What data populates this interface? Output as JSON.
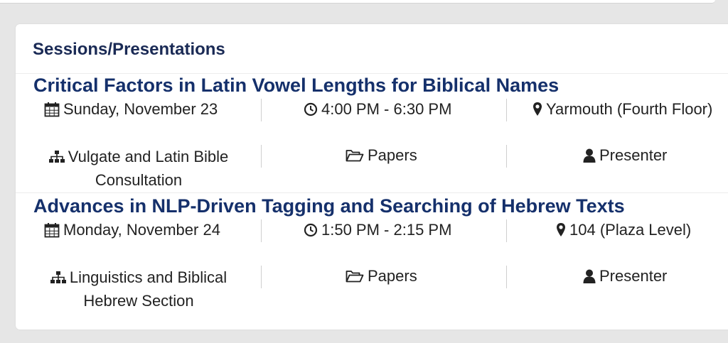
{
  "section_title": "Sessions/Presentations",
  "sessions": [
    {
      "title": "Critical Factors in Latin Vowel Lengths for Biblical Names",
      "date": "Sunday, November 23",
      "time": "4:00 PM - 6:30 PM",
      "location": "Yarmouth (Fourth Floor)",
      "unit": "Vulgate and Latin Bible Consultation",
      "type": "Papers",
      "role": "Presenter"
    },
    {
      "title": "Advances in NLP-Driven Tagging and Searching of Hebrew Texts",
      "date": "Monday, November 24",
      "time": "1:50 PM - 2:15 PM",
      "location": "104 (Plaza Level)",
      "unit": "Linguistics and Biblical Hebrew Section",
      "type": "Papers",
      "role": "Presenter"
    }
  ],
  "colors": {
    "page_bg": "#e6e6e6",
    "card_bg": "#ffffff",
    "heading": "#1a2a55",
    "title_link": "#15306b",
    "text": "#222222"
  },
  "icons": {
    "date": "calendar-icon",
    "time": "clock-icon",
    "location": "map-marker-icon",
    "unit": "sitemap-icon",
    "type": "folder-open-icon",
    "role": "user-icon"
  }
}
